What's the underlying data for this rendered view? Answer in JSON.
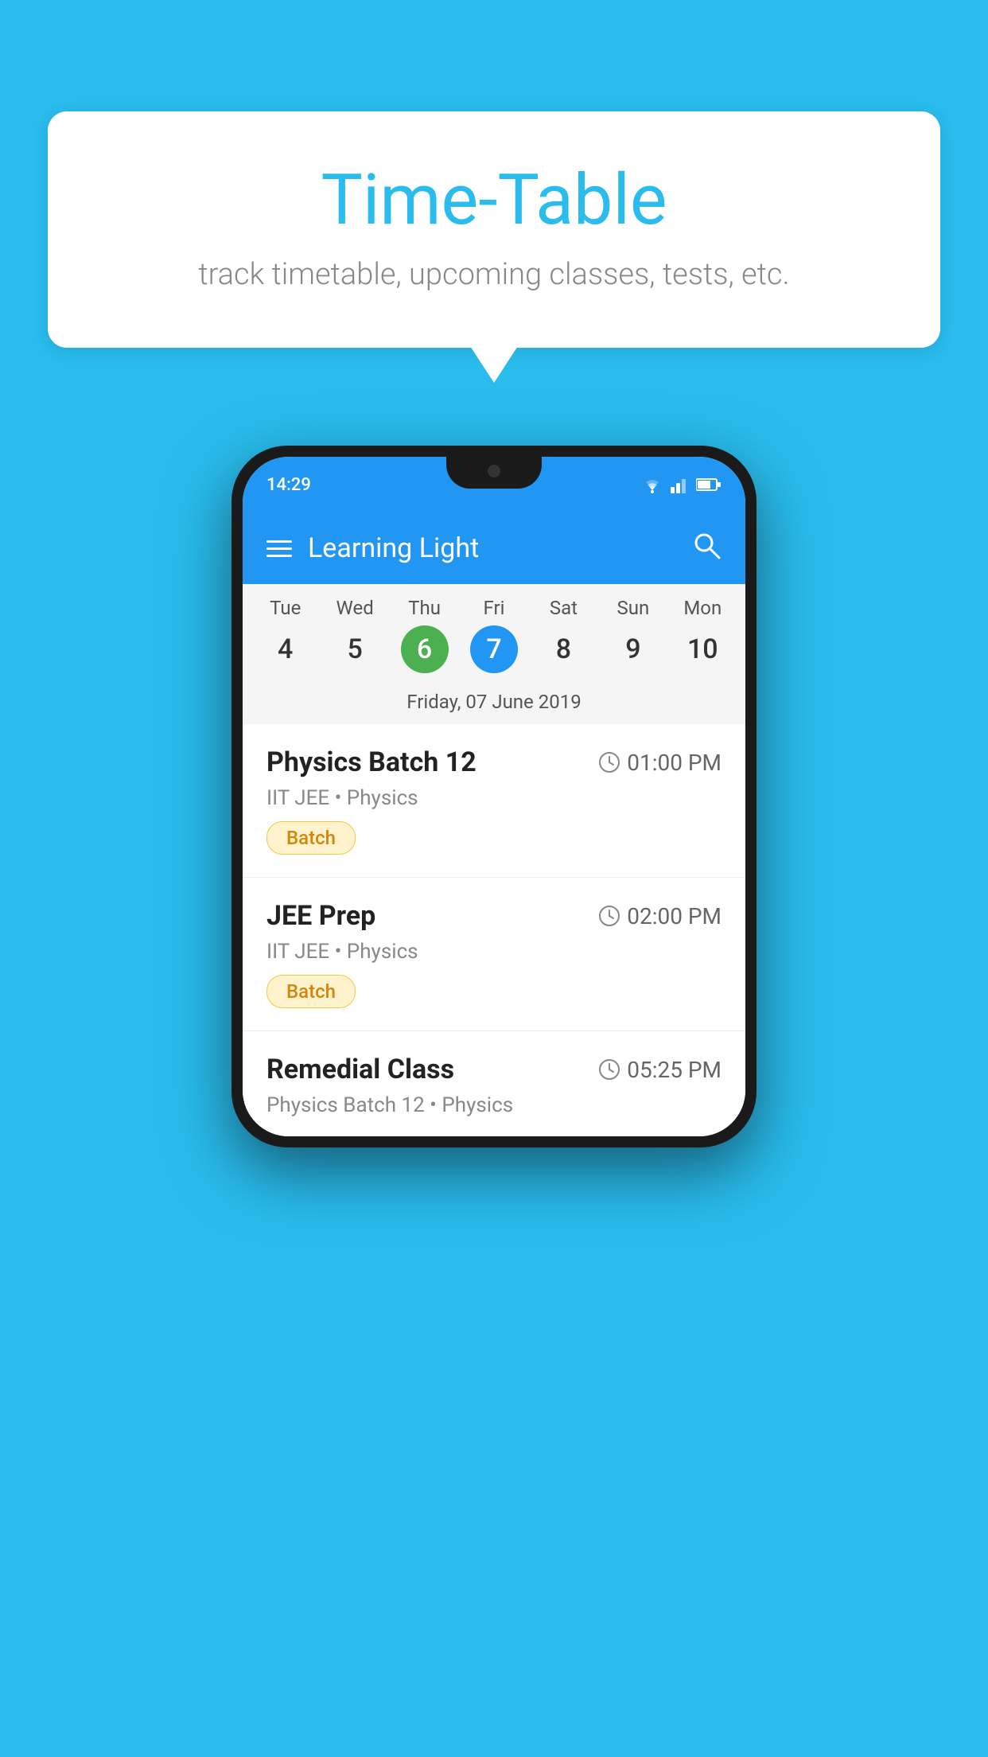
{
  "background": {
    "color": "#29BCEC"
  },
  "speech_bubble": {
    "title": "Time-Table",
    "subtitle": "track timetable, upcoming classes, tests, etc."
  },
  "phone": {
    "status_bar": {
      "time": "14:29"
    },
    "app_bar": {
      "menu_label": "menu",
      "title": "Learning Light",
      "search_label": "search"
    },
    "calendar": {
      "days": [
        "Tue",
        "Wed",
        "Thu",
        "Fri",
        "Sat",
        "Sun",
        "Mon"
      ],
      "dates": [
        "4",
        "5",
        "6",
        "7",
        "8",
        "9",
        "10"
      ],
      "today_index": 2,
      "selected_index": 3,
      "selected_date_label": "Friday, 07 June 2019"
    },
    "schedule": [
      {
        "title": "Physics Batch 12",
        "time": "01:00 PM",
        "subtitle": "IIT JEE • Physics",
        "tag": "Batch"
      },
      {
        "title": "JEE Prep",
        "time": "02:00 PM",
        "subtitle": "IIT JEE • Physics",
        "tag": "Batch"
      },
      {
        "title": "Remedial Class",
        "time": "05:25 PM",
        "subtitle": "Physics Batch 12 • Physics",
        "tag": null
      }
    ]
  }
}
